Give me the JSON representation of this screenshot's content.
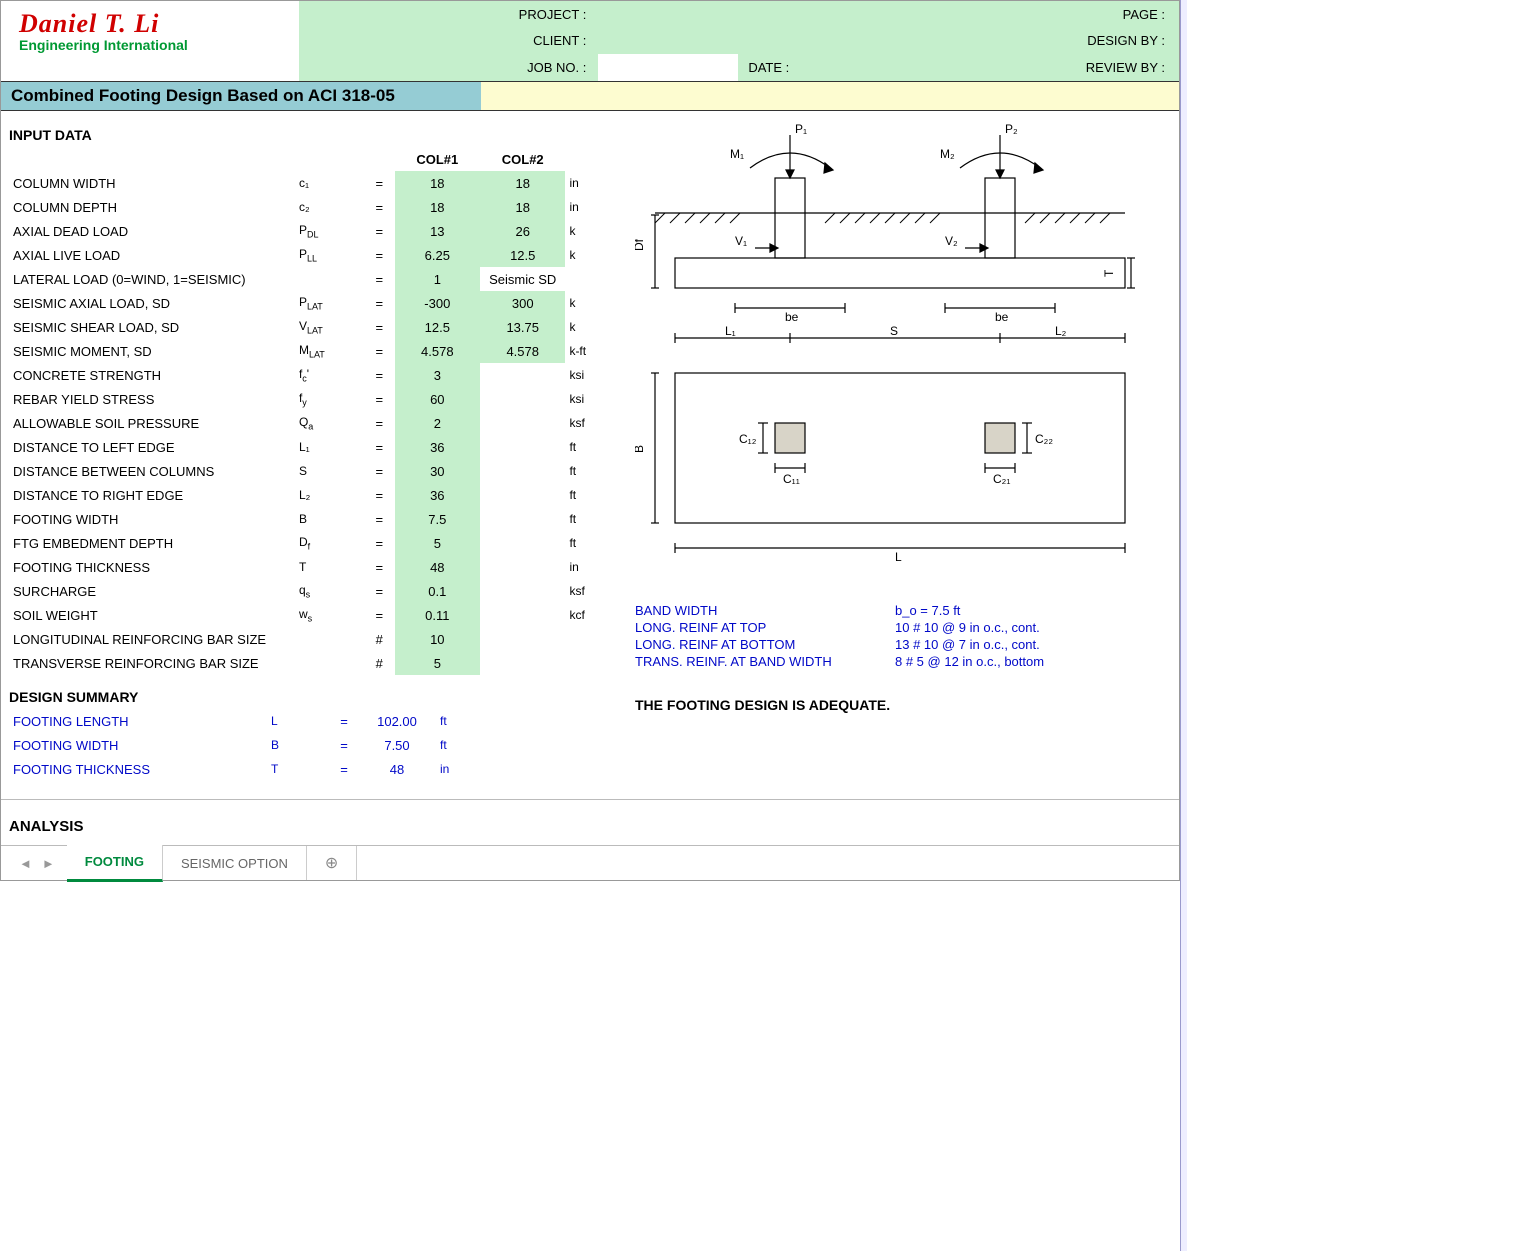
{
  "brand": {
    "name": "Daniel T. Li",
    "sub": "Engineering International"
  },
  "meta": {
    "project_label": "PROJECT :",
    "client_label": "CLIENT :",
    "jobno_label": "JOB NO. :",
    "date_label": "DATE :",
    "page_label": "PAGE :",
    "designby_label": "DESIGN BY :",
    "reviewby_label": "REVIEW BY :"
  },
  "title": "Combined Footing Design Based on ACI 318-05",
  "input": {
    "heading": "INPUT DATA",
    "col1_h": "COL#1",
    "col2_h": "COL#2",
    "rows": [
      {
        "label": "COLUMN WIDTH",
        "sym": "c₁",
        "eq": "=",
        "c1": "18",
        "c2": "18",
        "unit": "in"
      },
      {
        "label": "COLUMN DEPTH",
        "sym": "c₂",
        "eq": "=",
        "c1": "18",
        "c2": "18",
        "unit": "in"
      },
      {
        "label": "AXIAL DEAD LOAD",
        "sym": "P_DL",
        "sub": "DL",
        "base": "P",
        "eq": "=",
        "c1": "13",
        "c2": "26",
        "unit": "k"
      },
      {
        "label": "AXIAL LIVE LOAD",
        "sym": "P_LL",
        "sub": "LL",
        "base": "P",
        "eq": "=",
        "c1": "6.25",
        "c2": "12.5",
        "unit": "k"
      },
      {
        "label": "LATERAL LOAD (0=WIND, 1=SEISMIC)",
        "sym": "",
        "eq": "=",
        "c1": "1",
        "c2": "Seismic SD",
        "unit": ""
      },
      {
        "label": "SEISMIC AXIAL LOAD, SD",
        "sym": "P_LAT",
        "sub": "LAT",
        "base": "P",
        "eq": "=",
        "c1": "-300",
        "c2": "300",
        "unit": "k"
      },
      {
        "label": "SEISMIC SHEAR LOAD, SD",
        "sym": "V_LAT",
        "sub": "LAT",
        "base": "V",
        "eq": "=",
        "c1": "12.5",
        "c2": "13.75",
        "unit": "k"
      },
      {
        "label": "SEISMIC MOMENT, SD",
        "sym": "M_LAT",
        "sub": "LAT",
        "base": "M",
        "eq": "=",
        "c1": "4.578",
        "c2": "4.578",
        "unit": "k-ft"
      },
      {
        "label": "CONCRETE STRENGTH",
        "sym": "f_c'",
        "sub": "c",
        "base": "f",
        "suffix": "'",
        "eq": "=",
        "c1": "3",
        "unit": "ksi"
      },
      {
        "label": "REBAR YIELD STRESS",
        "sym": "f_y",
        "sub": "y",
        "base": "f",
        "eq": "=",
        "c1": "60",
        "unit": "ksi"
      },
      {
        "label": "ALLOWABLE SOIL PRESSURE",
        "sym": "Q_a",
        "sub": "a",
        "base": "Q",
        "eq": "=",
        "c1": "2",
        "unit": "ksf"
      },
      {
        "label": "DISTANCE TO LEFT EDGE",
        "sym": "L₁",
        "eq": "=",
        "c1": "36",
        "unit": "ft"
      },
      {
        "label": "DISTANCE BETWEEN COLUMNS",
        "sym": "S",
        "eq": "=",
        "c1": "30",
        "unit": "ft"
      },
      {
        "label": "DISTANCE TO RIGHT EDGE",
        "sym": "L₂",
        "eq": "=",
        "c1": "36",
        "unit": "ft"
      },
      {
        "label": "FOOTING WIDTH",
        "sym": "B",
        "eq": "=",
        "c1": "7.5",
        "unit": "ft"
      },
      {
        "label": "FTG EMBEDMENT DEPTH",
        "sym": "D_f",
        "sub": "f",
        "base": "D",
        "eq": "=",
        "c1": "5",
        "unit": "ft"
      },
      {
        "label": "FOOTING THICKNESS",
        "sym": "T",
        "eq": "=",
        "c1": "48",
        "unit": "in"
      },
      {
        "label": "SURCHARGE",
        "sym": "q_s",
        "sub": "s",
        "base": "q",
        "eq": "=",
        "c1": "0.1",
        "unit": "ksf"
      },
      {
        "label": "SOIL WEIGHT",
        "sym": "w_s",
        "sub": "s",
        "base": "w",
        "eq": "=",
        "c1": "0.11",
        "unit": "kcf"
      },
      {
        "label": "LONGITUDINAL REINFORCING BAR SIZE",
        "sym": "",
        "eq": "#",
        "c1": "10",
        "unit": ""
      },
      {
        "label": "TRANSVERSE REINFORCING BAR SIZE",
        "sym": "",
        "eq": "#",
        "c1": "5",
        "unit": ""
      }
    ]
  },
  "summary": {
    "heading": "DESIGN SUMMARY",
    "rows": [
      {
        "label": "FOOTING LENGTH",
        "sym": "L",
        "eq": "=",
        "val": "102.00",
        "unit": "ft"
      },
      {
        "label": "FOOTING WIDTH",
        "sym": "B",
        "eq": "=",
        "val": "7.50",
        "unit": "ft"
      },
      {
        "label": "FOOTING THICKNESS",
        "sym": "T",
        "eq": "=",
        "val": "48",
        "unit": "in"
      }
    ]
  },
  "analysis_heading": "ANALYSIS",
  "diagram_labels": {
    "P1": "P₁",
    "P2": "P₂",
    "M1": "M₁",
    "M2": "M₂",
    "V1": "V₁",
    "V2": "V₂",
    "Df": "Df",
    "T": "T",
    "be": "be",
    "L1": "L₁",
    "S": "S",
    "L2": "L₂",
    "B": "B",
    "L": "L",
    "C11": "C₁₁",
    "C12": "C₁₂",
    "C21": "C₂₁",
    "C22": "C₂₂"
  },
  "results": {
    "rows": [
      {
        "k": "BAND WIDTH",
        "v": "b_o  =        7.5     ft"
      },
      {
        "k": "LONG. REINF AT TOP",
        "v": "10 # 10 @ 9 in o.c., cont."
      },
      {
        "k": "LONG. REINF AT BOTTOM",
        "v": "13 # 10 @ 7 in o.c., cont."
      },
      {
        "k": "TRANS. REINF. AT BAND WIDTH",
        "v": "8 # 5 @ 12 in o.c., bottom"
      }
    ],
    "adequate": "THE FOOTING DESIGN IS ADEQUATE."
  },
  "tabs": {
    "active": "FOOTING",
    "other": "SEISMIC OPTION"
  }
}
